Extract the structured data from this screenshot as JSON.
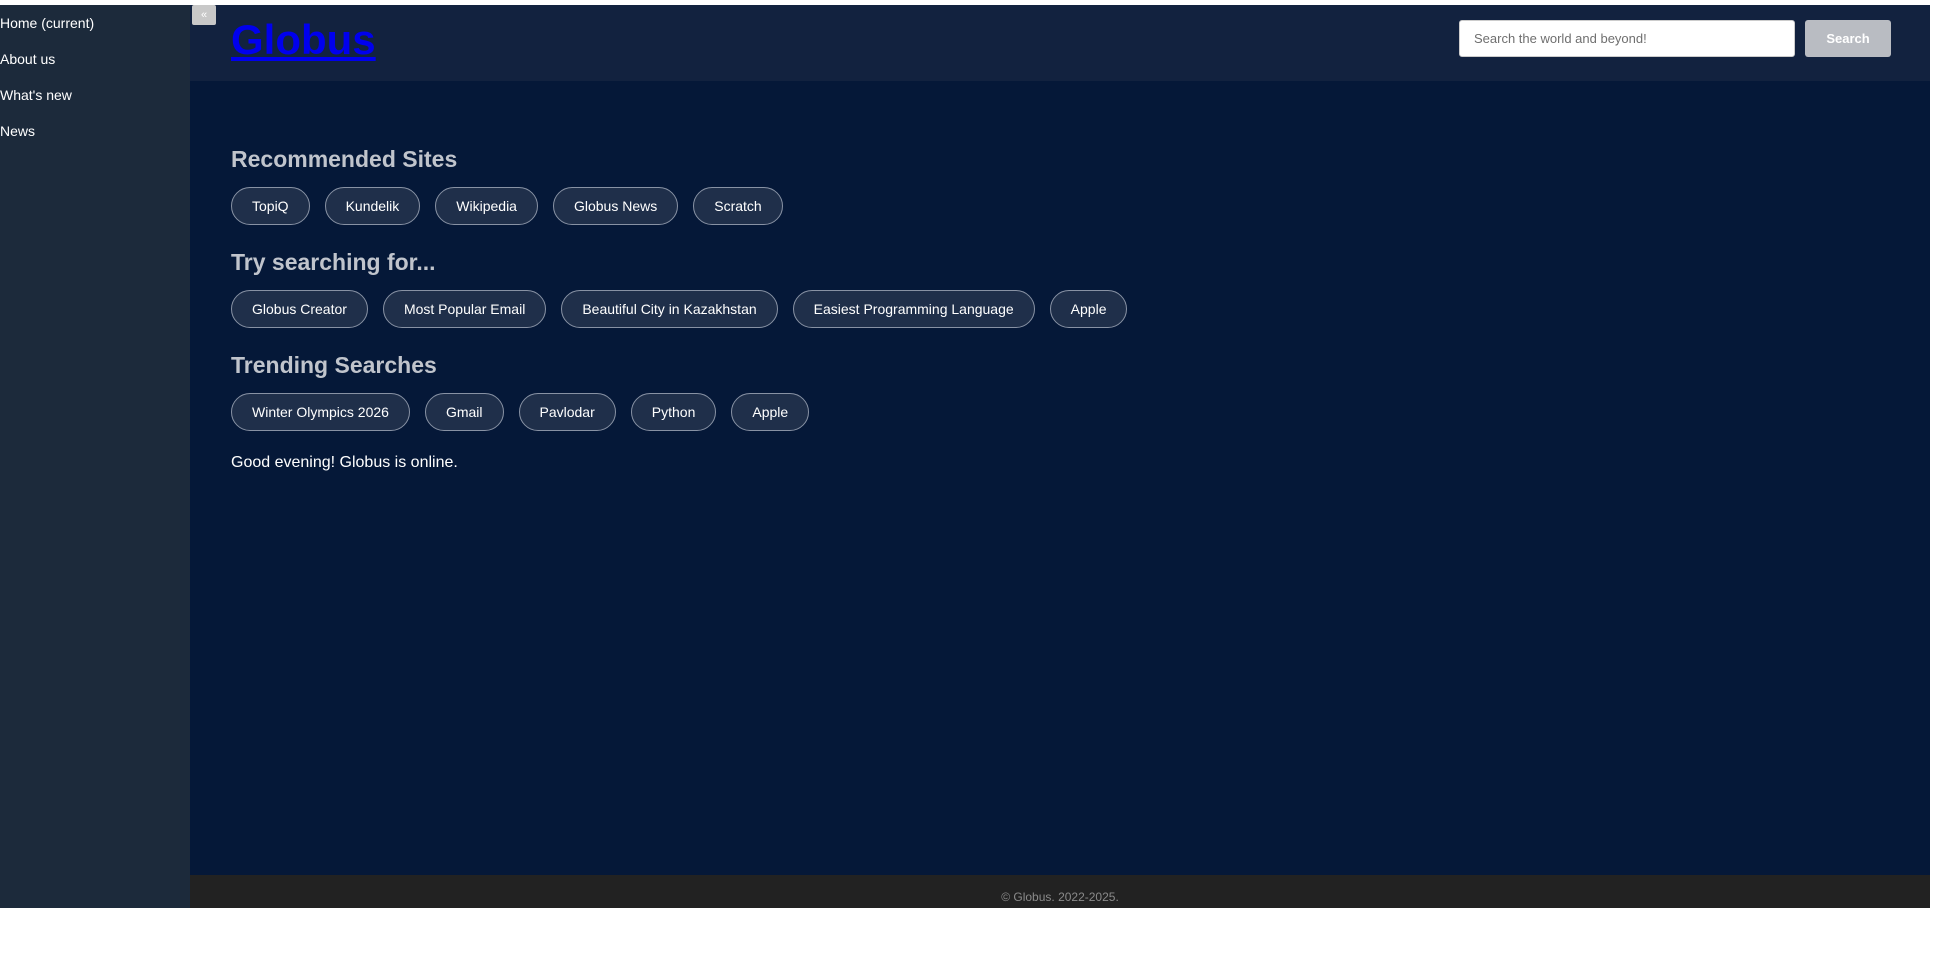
{
  "sidebar": {
    "items": [
      {
        "label": "Home (current)"
      },
      {
        "label": "About us"
      },
      {
        "label": "What's new"
      },
      {
        "label": "News"
      }
    ],
    "collapse_label": "«"
  },
  "header": {
    "logo": "Globus",
    "search_placeholder": "Search the world and beyond!",
    "search_button": "Search"
  },
  "sections": [
    {
      "title": "Recommended Sites",
      "pills": [
        "TopiQ",
        "Kundelik",
        "Wikipedia",
        "Globus News",
        "Scratch"
      ]
    },
    {
      "title": "Try searching for...",
      "pills": [
        "Globus Creator",
        "Most Popular Email",
        "Beautiful City in Kazakhstan",
        "Easiest Programming Language",
        "Apple"
      ]
    },
    {
      "title": "Trending Searches",
      "pills": [
        "Winter Olympics 2026",
        "Gmail",
        "Pavlodar",
        "Python",
        "Apple"
      ]
    }
  ],
  "status": "Good evening! Globus is online.",
  "footer": "© Globus. 2022-2025.",
  "colors": {
    "sidebar_bg": "#1c2a3b",
    "header_bg": "#12223f",
    "main_bg": "#051838",
    "footer_bg": "#222222",
    "logo": "#0000ee"
  }
}
